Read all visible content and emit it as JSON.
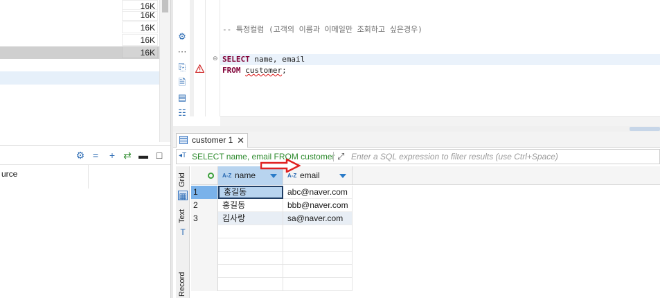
{
  "navigator": {
    "size_rows": [
      {
        "size": "16K",
        "selected": false
      },
      {
        "size": "16K",
        "selected": false
      },
      {
        "size": "16K",
        "selected": false
      },
      {
        "size": "16K",
        "selected": false
      },
      {
        "size": "16K",
        "selected": true
      }
    ]
  },
  "left_bottom": {
    "row_text": "urce"
  },
  "editor": {
    "comment_line": "-- 특정컬럼 (고객의 이름과 이메일만 조회하고 싶은경우)",
    "line1_keyword": "SELECT",
    "line1_rest": " name, email",
    "line2_keyword": "FROM",
    "line2_table": "customer",
    "line2_end": ";"
  },
  "results": {
    "tab_label": "customer 1",
    "filter_query": "SELECT name, email FROM customer",
    "filter_placeholder": "Enter a SQL expression to filter results (use Ctrl+Space)",
    "side_tabs": {
      "grid": "Grid",
      "text": "Text",
      "record": "Record"
    },
    "columns": [
      {
        "label": "name",
        "type_icon": "A-Z"
      },
      {
        "label": "email",
        "type_icon": "A-Z"
      }
    ],
    "rows": [
      {
        "num": "1",
        "name": "홍길동",
        "email": "abc@naver.com"
      },
      {
        "num": "2",
        "name": "홍길동",
        "email": "bbb@naver.com"
      },
      {
        "num": "3",
        "name": "김사랑",
        "email": "sa@naver.com"
      }
    ]
  },
  "colors": {
    "keyword": "#7f0037",
    "filter_query": "#2e8b2e",
    "selection": "#b8d4ef",
    "annotation_arrow": "#e02020"
  }
}
